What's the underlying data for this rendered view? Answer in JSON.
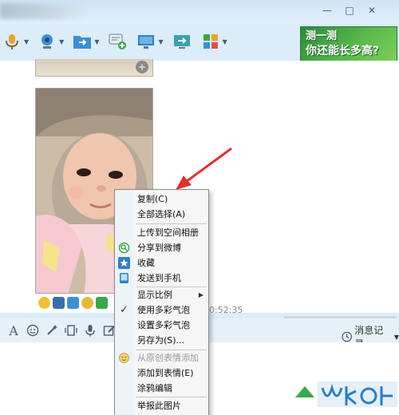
{
  "ad": {
    "line1": "测一测",
    "line2": "你还能长多高?"
  },
  "message": {
    "time": "0:52:35"
  },
  "history": {
    "label": "消息记录"
  },
  "context_menu": {
    "items": [
      {
        "label": "复制(C)"
      },
      {
        "label": "全部选择(A)"
      },
      {
        "label": "上传到空间相册"
      },
      {
        "label": "分享到微博"
      },
      {
        "label": "收藏"
      },
      {
        "label": "发送到手机"
      },
      {
        "label": "显示比例"
      },
      {
        "label": "使用多彩气泡"
      },
      {
        "label": "设置多彩气泡"
      },
      {
        "label": "另存为(S)..."
      },
      {
        "label": "从原创表情添加"
      },
      {
        "label": "添加到表情(E)"
      },
      {
        "label": "涂鸦编辑"
      },
      {
        "label": "举报此图片"
      }
    ]
  },
  "colors": {
    "accent": "#2c8a3c",
    "arrow": "#e03030",
    "menu_bg": "#f6f6f6"
  }
}
